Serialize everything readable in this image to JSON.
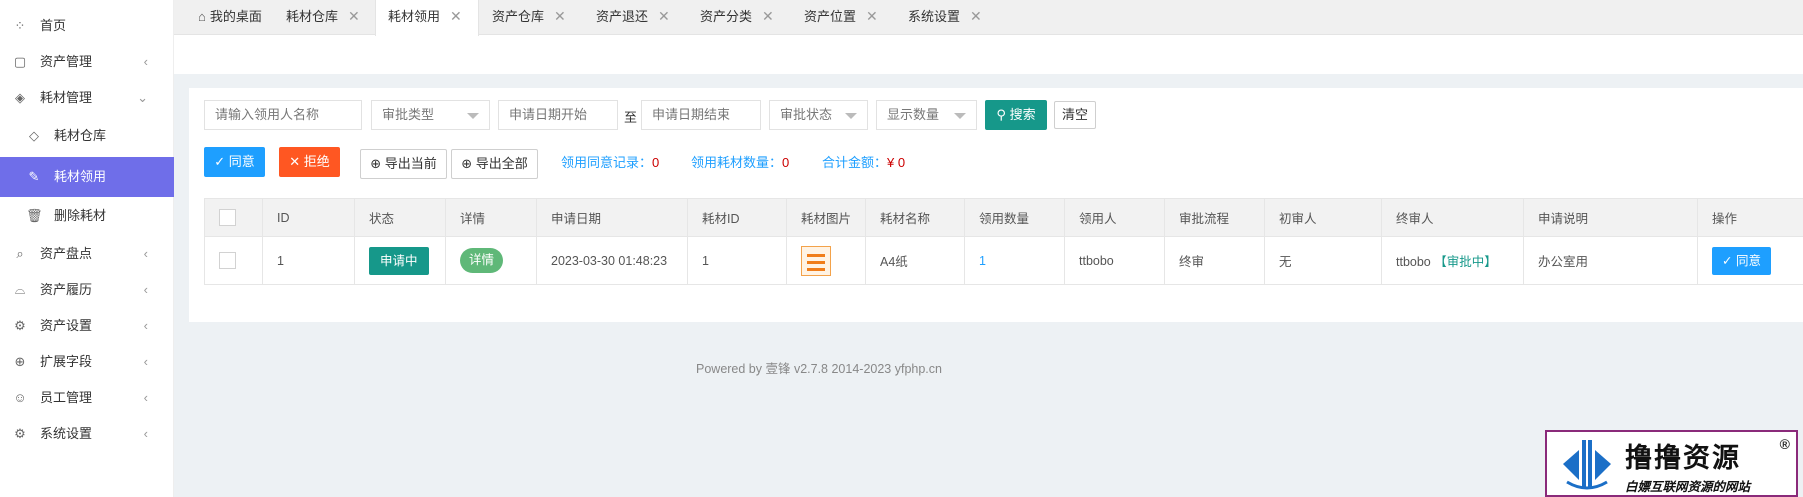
{
  "sidebar": {
    "items": [
      {
        "label": "首页",
        "icon": "dashboard-icon"
      },
      {
        "label": "资产管理",
        "icon": "box-icon",
        "arrow": "‹"
      },
      {
        "label": "耗材管理",
        "icon": "cube-icon",
        "arrow": "⌄"
      },
      {
        "label": "耗材仓库",
        "icon": "cube-small-icon"
      },
      {
        "label": "耗材领用",
        "icon": "edit-icon"
      },
      {
        "label": "删除耗材",
        "icon": "trash-icon"
      },
      {
        "label": "资产盘点",
        "icon": "search-icon",
        "arrow": "‹"
      },
      {
        "label": "资产履历",
        "icon": "sofa-icon",
        "arrow": "‹"
      },
      {
        "label": "资产设置",
        "icon": "gear-icon",
        "arrow": "‹"
      },
      {
        "label": "扩展字段",
        "icon": "extend-icon",
        "arrow": "‹"
      },
      {
        "label": "员工管理",
        "icon": "user-icon",
        "arrow": "‹"
      },
      {
        "label": "系统设置",
        "icon": "settings-icon",
        "arrow": "‹"
      }
    ],
    "active_index": 4
  },
  "tabs": [
    {
      "label": "我的桌面",
      "icon": "home-icon"
    },
    {
      "label": "耗材仓库",
      "close": "✕"
    },
    {
      "label": "耗材领用",
      "close": "✕"
    },
    {
      "label": "资产仓库",
      "close": "✕"
    },
    {
      "label": "资产退还",
      "close": "✕"
    },
    {
      "label": "资产分类",
      "close": "✕"
    },
    {
      "label": "资产位置",
      "close": "✕"
    },
    {
      "label": "系统设置",
      "close": "✕"
    }
  ],
  "active_tab": 2,
  "filters": {
    "applicant_placeholder": "请输入领用人名称",
    "approval_type": "审批类型",
    "start_date_placeholder": "申请日期开始",
    "range_sep": "至",
    "end_date_placeholder": "申请日期结束",
    "approval_status": "审批状态",
    "display_count": "显示数量",
    "search_label": "搜索",
    "clear_label": "清空"
  },
  "actions": {
    "agree_label": "同意",
    "reject_label": "拒绝",
    "export_current_label": "导出当前",
    "export_all_label": "导出全部"
  },
  "stats": {
    "agree_records_label": "领用同意记录：",
    "agree_records_value": "0",
    "consumable_count_label": "领用耗材数量：",
    "consumable_count_value": "0",
    "total_amount_label": "合计金额：",
    "total_amount_value": "¥ 0"
  },
  "table": {
    "headers": [
      "ID",
      "状态",
      "详情",
      "申请日期",
      "耗材ID",
      "耗材图片",
      "耗材名称",
      "领用数量",
      "领用人",
      "审批流程",
      "初审人",
      "终审人",
      "申请说明",
      "操作"
    ],
    "rows": [
      {
        "id": "1",
        "status": "申请中",
        "detail": "详情",
        "date": "2023-03-30 01:48:23",
        "consumable_id": "1",
        "name": "A4纸",
        "quantity": "1",
        "applicant": "ttbobo",
        "flow": "终审",
        "first_reviewer": "无",
        "final_reviewer": "ttbobo",
        "final_status": "【审批中】",
        "note": "办公室用",
        "op_label": "同意"
      }
    ]
  },
  "footer": {
    "text": "Powered by 壹锋 v2.7.8 2014-2023 yfphp.cn"
  },
  "watermark": {
    "title": "撸撸资源",
    "subtitle": "白嫖互联网资源的网站",
    "reg": "®"
  },
  "colors": {
    "active_nav": "#6f6ee9",
    "teal": "#16988a",
    "blue": "#1e9fff",
    "orange": "#ff5722",
    "red_value": "#cc0000"
  }
}
